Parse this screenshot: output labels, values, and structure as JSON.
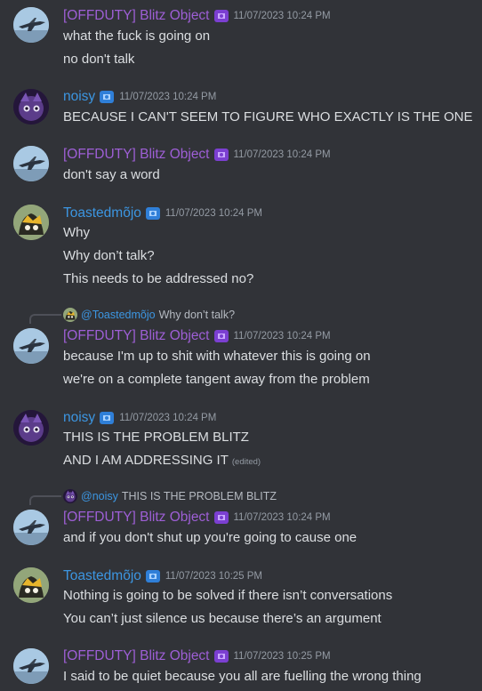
{
  "users": {
    "blitz": {
      "name": "[OFFDUTY] Blitz Object",
      "color": "#9e5fd6",
      "badge": "role-badge-icon"
    },
    "noisy": {
      "name": "noisy",
      "color": "#3c96e2",
      "badge": "role-badge-icon"
    },
    "toast": {
      "name": "Toastedmõjo",
      "color": "#3c96e2",
      "badge": "role-badge-icon"
    }
  },
  "messages": [
    {
      "author": "[OFFDUTY] Blitz Object",
      "timestamp": "11/07/2023 10:24 PM",
      "lines": [
        "what the fuck is going on",
        "no don't talk"
      ]
    },
    {
      "author": "noisy",
      "timestamp": "11/07/2023 10:24 PM",
      "lines": [
        "BECAUSE I CAN'T SEEM TO FIGURE WHO EXACTLY IS THE ONE"
      ]
    },
    {
      "author": "[OFFDUTY] Blitz Object",
      "timestamp": "11/07/2023 10:24 PM",
      "lines": [
        "don't say a word"
      ]
    },
    {
      "author": "Toastedmõjo",
      "timestamp": "11/07/2023 10:24 PM",
      "lines": [
        "Why",
        "Why don’t talk?",
        "This needs to be addressed no?"
      ]
    },
    {
      "author": "[OFFDUTY] Blitz Object",
      "timestamp": "11/07/2023 10:24 PM",
      "reply": {
        "name": "@Toastedmõjo",
        "text": "Why don’t talk?"
      },
      "lines": [
        "because I'm up to shit with whatever this is going on",
        "we're on a complete tangent away from the problem"
      ]
    },
    {
      "author": "noisy",
      "timestamp": "11/07/2023 10:24 PM",
      "lines": [
        "THIS IS THE PROBLEM BLITZ",
        "AND I AM ADDRESSING IT"
      ],
      "edited": "(edited)"
    },
    {
      "author": "[OFFDUTY] Blitz Object",
      "timestamp": "11/07/2023 10:24 PM",
      "reply": {
        "name": "@noisy",
        "text": "THIS IS THE PROBLEM BLITZ"
      },
      "lines": [
        "and if you don't shut up you're going to cause one"
      ]
    },
    {
      "author": "Toastedmõjo",
      "timestamp": "11/07/2023 10:25 PM",
      "lines": [
        "Nothing is going to be solved if there isn’t conversations",
        "You can’t just silence us because there’s an argument"
      ]
    },
    {
      "author": "[OFFDUTY] Blitz Object",
      "timestamp": "11/07/2023 10:25 PM",
      "lines": [
        "I said to be quiet because you all are fuelling the wrong thing"
      ]
    }
  ]
}
